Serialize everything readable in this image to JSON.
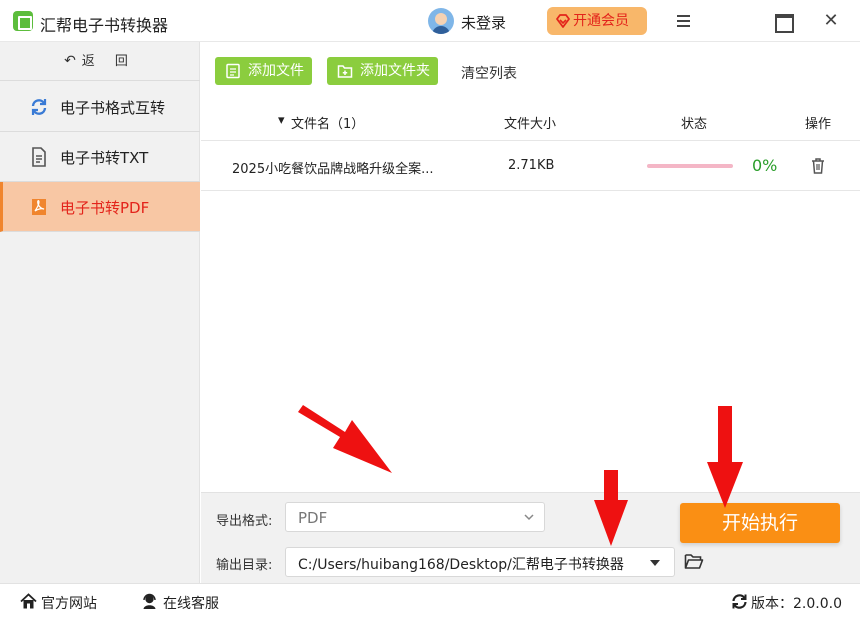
{
  "app": {
    "title": "汇帮电子书转换器"
  },
  "user": {
    "status": "未登录"
  },
  "vip": {
    "label": "开通会员"
  },
  "sidebar": {
    "back_label": "返 回",
    "items": [
      {
        "label": "电子书格式互转",
        "icon": "refresh-icon"
      },
      {
        "label": "电子书转TXT",
        "icon": "document-icon"
      },
      {
        "label": "电子书转PDF",
        "icon": "pdf-icon",
        "active": true
      }
    ]
  },
  "toolbar": {
    "add_file": "添加文件",
    "add_folder": "添加文件夹",
    "clear": "清空列表"
  },
  "table": {
    "columns": {
      "name": "文件名（1）",
      "size": "文件大小",
      "status": "状态",
      "action": "操作"
    },
    "rows": [
      {
        "name": "2025小吃餐饮品牌战略升级全案...",
        "size": "2.71KB",
        "progress": 0,
        "progress_label": "0%"
      }
    ]
  },
  "export": {
    "format_label": "导出格式:",
    "format_value": "PDF",
    "dir_label": "输出目录:",
    "dir_value": "C:/Users/huibang168/Desktop/汇帮电子书转换器",
    "start_label": "开始执行"
  },
  "statusbar": {
    "website": "官方网站",
    "support": "在线客服",
    "version": "版本：2.0.0.0"
  },
  "colors": {
    "accent_green": "#8bcd3e",
    "accent_orange": "#fa8f14",
    "active_sidebar": "#f8c7a4",
    "active_text": "#e3241b",
    "arrow_red": "#ee1111"
  }
}
